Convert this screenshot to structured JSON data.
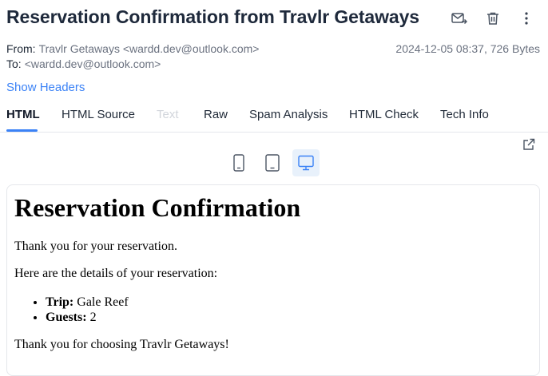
{
  "email": {
    "subject": "Reservation Confirmation from Travlr Getaways",
    "from_label": "From:",
    "from_value": "Travlr Getaways <wardd.dev@outlook.com>",
    "to_label": "To:",
    "to_value": "<wardd.dev@outlook.com>",
    "date_size": "2024-12-05 08:37, 726 Bytes",
    "show_headers": "Show Headers"
  },
  "actions": [
    {
      "name": "forward-icon"
    },
    {
      "name": "trash-icon"
    },
    {
      "name": "more-vertical-icon"
    }
  ],
  "tabs": [
    {
      "label": "HTML",
      "state": "active"
    },
    {
      "label": "HTML Source",
      "state": "normal"
    },
    {
      "label": "Text",
      "state": "disabled"
    },
    {
      "label": "Raw",
      "state": "normal"
    },
    {
      "label": "Spam Analysis",
      "state": "normal"
    },
    {
      "label": "HTML Check",
      "state": "normal"
    },
    {
      "label": "Tech Info",
      "state": "normal"
    }
  ],
  "devices": [
    {
      "name": "phone-icon",
      "active": false
    },
    {
      "name": "tablet-icon",
      "active": false
    },
    {
      "name": "desktop-icon",
      "active": true
    }
  ],
  "colors": {
    "accent": "#3b82f6",
    "active_device_bg": "#e8f1fb"
  },
  "body": {
    "heading": "Reservation Confirmation",
    "para1": "Thank you for your reservation.",
    "para2": "Here are the details of your reservation:",
    "details": [
      {
        "label": "Trip:",
        "value": "Gale Reef"
      },
      {
        "label": "Guests:",
        "value": "2"
      }
    ],
    "para3": "Thank you for choosing Travlr Getaways!"
  }
}
